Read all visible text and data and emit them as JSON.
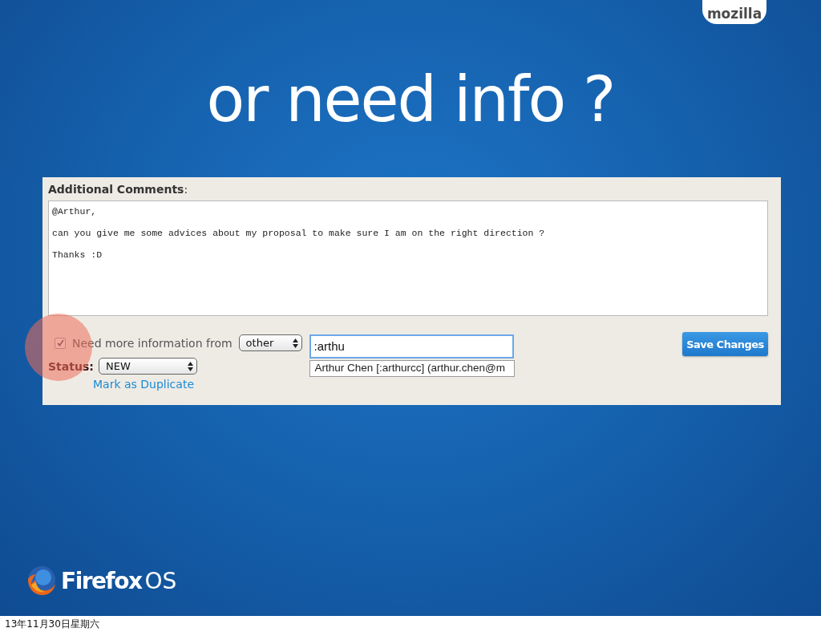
{
  "brand": "mozilla",
  "title": "or need info ?",
  "form": {
    "comments_label": "**Additional Comments**:",
    "comment_lines": [
      "@Arthur,",
      "can you give me some advices about my proposal to make sure I am on the right direction ?",
      "Thanks :D"
    ],
    "needinfo": {
      "checked": true,
      "label": "Need more information from",
      "role_select": "other",
      "user_value": ":arthu",
      "suggestion": "Arthur Chen [:arthurcc] (arthur.chen@m"
    },
    "status_label": "Status:",
    "status_select": "NEW",
    "duplicate_link": "Mark as Duplicate",
    "save_button": "Save Changes"
  },
  "logo": {
    "name": "Firefox",
    "suffix": "OS"
  },
  "footer_date": "13年11月30日星期六"
}
